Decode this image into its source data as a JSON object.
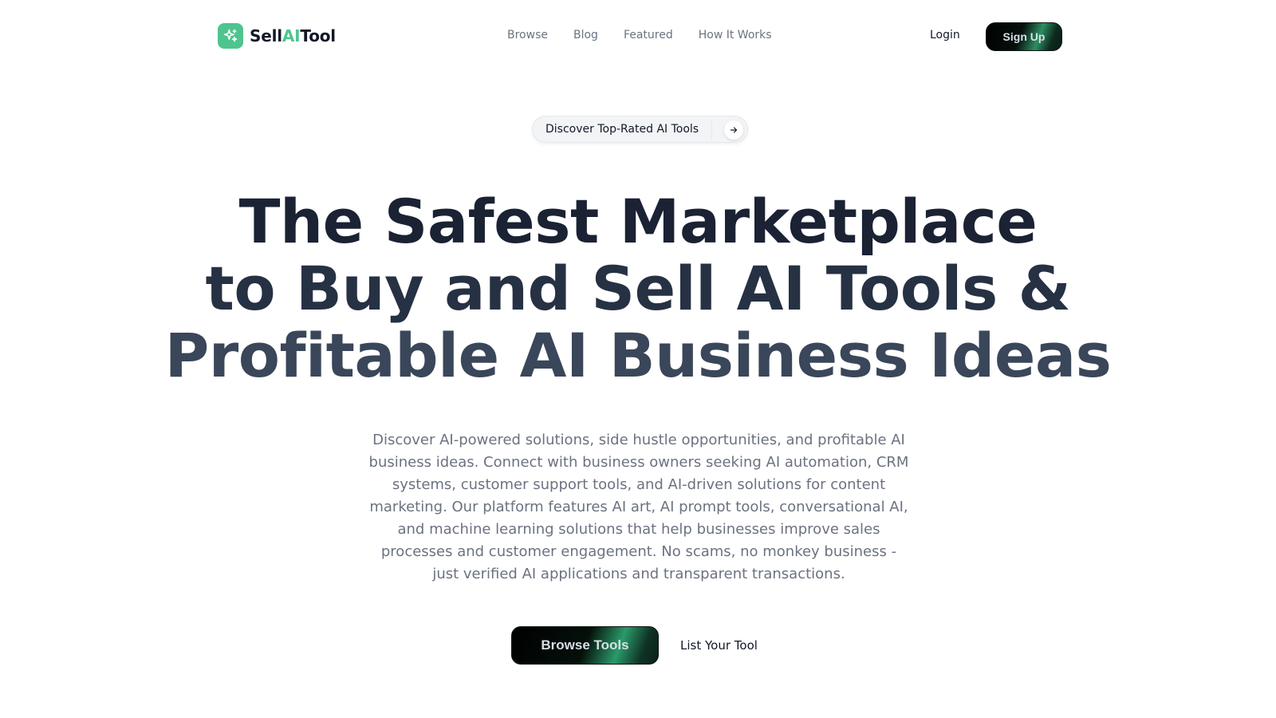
{
  "header": {
    "logo": {
      "prefix": "Sell",
      "accent": "AI",
      "suffix": "Tool",
      "icon": "sparkles-icon",
      "badge_color": "#4fc48f"
    },
    "nav": [
      {
        "label": "Browse"
      },
      {
        "label": "Blog"
      },
      {
        "label": "Featured"
      },
      {
        "label": "How It Works"
      }
    ],
    "login_label": "Login",
    "signup_label": "Sign Up"
  },
  "hero": {
    "pill": {
      "label": "Discover Top-Rated AI Tools",
      "icon": "arrow-right-icon"
    },
    "headline": [
      "The Safest Marketplace",
      "to Buy and Sell AI Tools &",
      "Profitable AI Business Ideas"
    ],
    "description": "Discover AI-powered solutions, side hustle opportunities, and profitable AI business ideas. Connect with business owners seeking AI automation, CRM systems, customer support tools, and AI-driven solutions for content marketing. Our platform features AI art, AI prompt tools, conversational AI, and machine learning solutions that help businesses improve sales processes and customer engagement. No scams, no monkey business - just verified AI applications and transparent transactions.",
    "primary_cta": "Browse Tools",
    "secondary_cta": "List Your Tool"
  },
  "colors": {
    "accent": "#4fc48f",
    "headline_dark": "#1a2233",
    "body_text": "#6b7280"
  }
}
